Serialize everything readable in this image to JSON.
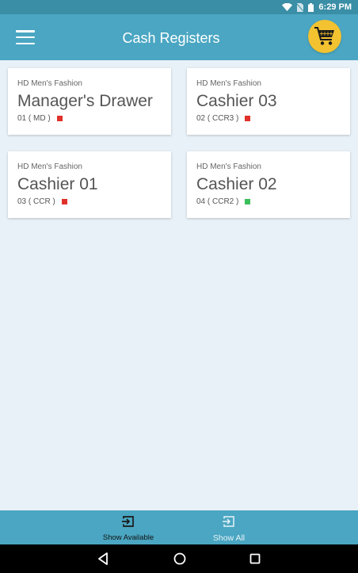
{
  "status_bar": {
    "time": "6:29 PM"
  },
  "app_bar": {
    "title": "Cash Registers"
  },
  "registers": [
    {
      "store": "HD Men's Fashion",
      "name": "Manager's Drawer",
      "code": "01 ( MD )",
      "status_color": "#e0312b"
    },
    {
      "store": "HD Men's Fashion",
      "name": "Cashier 03",
      "code": "02 ( CCR3 )",
      "status_color": "#e0312b"
    },
    {
      "store": "HD Men's Fashion",
      "name": "Cashier 01",
      "code": "03 ( CCR )",
      "status_color": "#e0312b"
    },
    {
      "store": "HD Men's Fashion",
      "name": "Cashier 02",
      "code": "04 ( CCR2 )",
      "status_color": "#3bbf5b"
    }
  ],
  "bottom_tabs": [
    {
      "label": "Show Available",
      "icon": "exit-to-app-icon",
      "active": true
    },
    {
      "label": "Show All",
      "icon": "exit-to-app-icon",
      "active": false
    }
  ],
  "colors": {
    "primary": "#4aa6c2",
    "status_bar": "#3a8ea6",
    "cart": "#f2c230",
    "background": "#e8f1f7"
  }
}
